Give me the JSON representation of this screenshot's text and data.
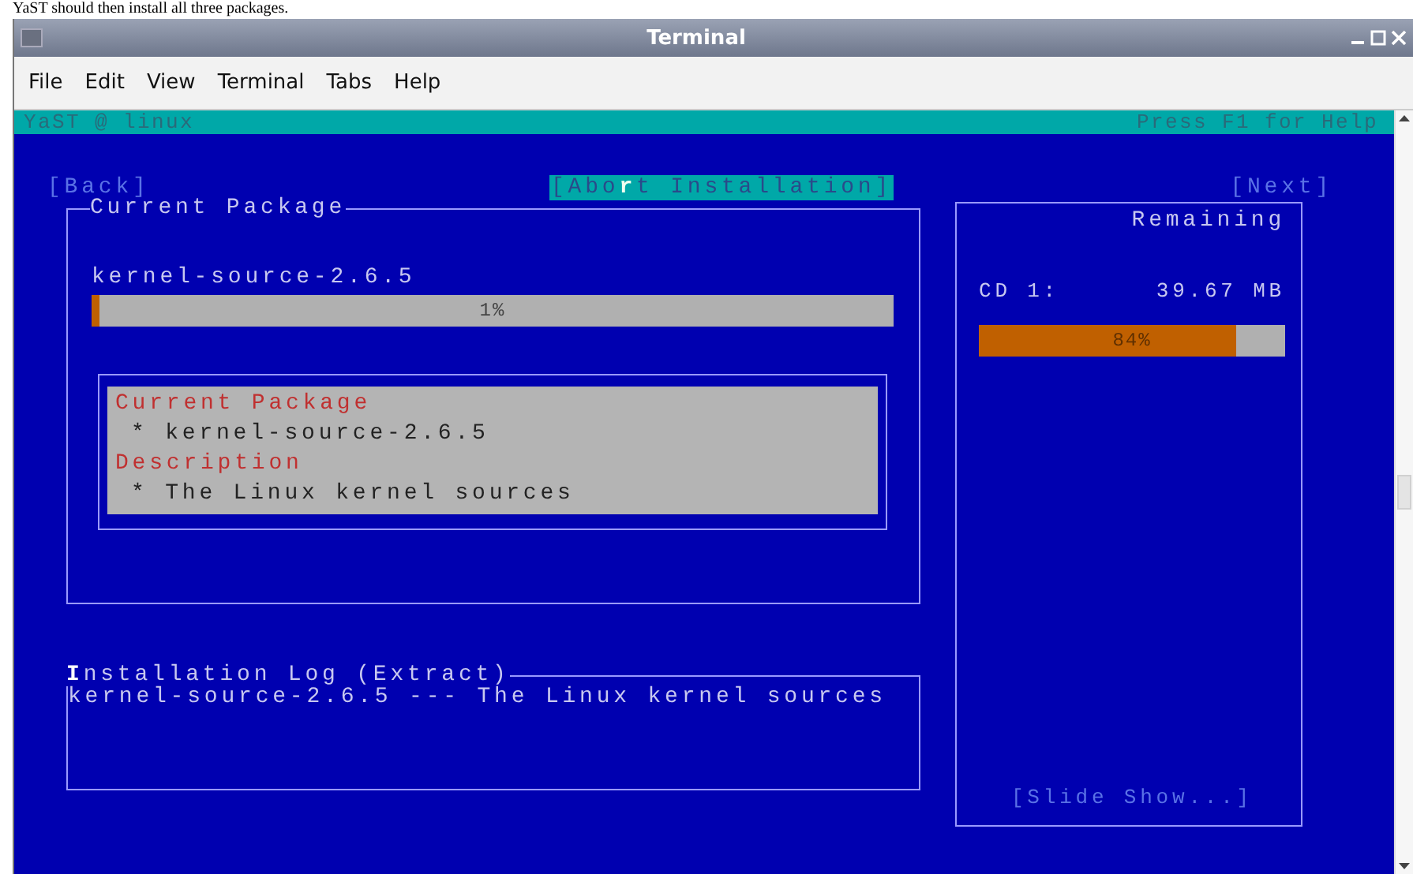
{
  "caption": "YaST should then install all three packages.",
  "window": {
    "title": "Terminal"
  },
  "menu": [
    "File",
    "Edit",
    "View",
    "Terminal",
    "Tabs",
    "Help"
  ],
  "status_line": {
    "left": "YaST @ linux",
    "right": "Press F1 for Help"
  },
  "nav": {
    "back": "[Back]",
    "abort_parts": [
      "[Abo",
      "r",
      "t Installation]"
    ],
    "next": "[Next]"
  },
  "current_package": {
    "title": "Current Package",
    "name": "kernel-source-2.6.5",
    "progress": {
      "level": 0.01,
      "reading": "1%"
    },
    "details": [
      {
        "kind": "heading",
        "text": "Current Package"
      },
      {
        "kind": "item",
        "text": "*  kernel-source-2.6.5"
      },
      {
        "kind": "heading",
        "text": "Description"
      },
      {
        "kind": "item",
        "text": "*  The Linux kernel sources"
      }
    ]
  },
  "log": {
    "title_parts": [
      "I",
      "nstallation Log (Extract)"
    ],
    "lines": [
      "kernel-source-2.6.5 --- The Linux kernel sources"
    ]
  },
  "remaining": {
    "title": "Remaining",
    "media": [
      {
        "label": "CD 1:",
        "size": "39.67 MB",
        "level": 0.84,
        "reading": "84%"
      }
    ],
    "slide_show": "[Slide Show...]"
  }
}
